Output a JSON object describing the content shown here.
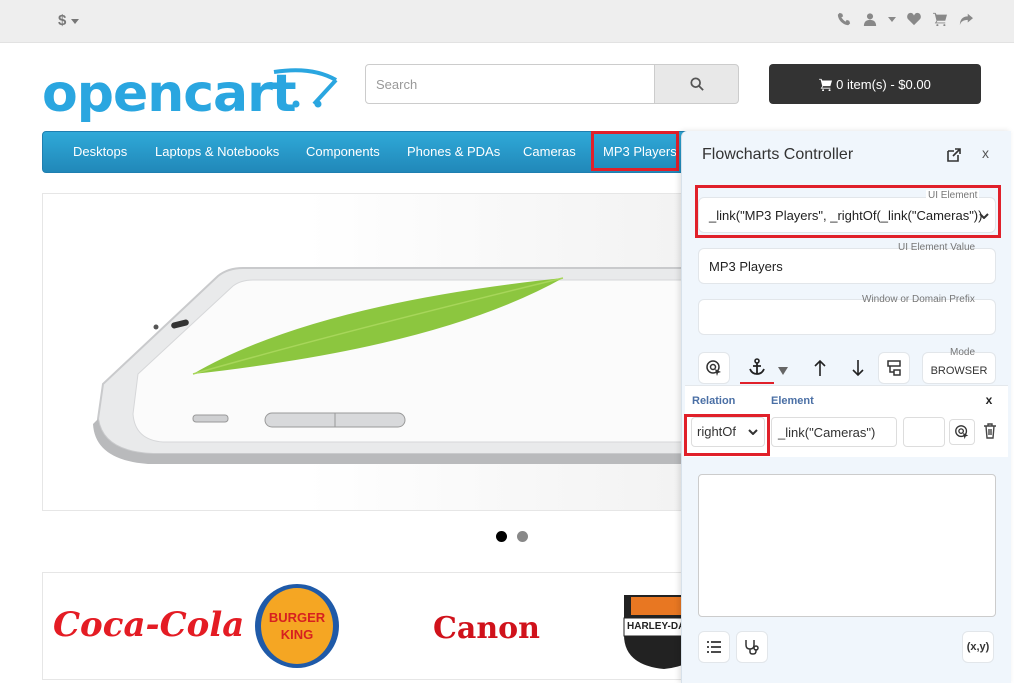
{
  "topbar": {
    "currency": "$"
  },
  "header": {
    "logo_text": "opencart",
    "search_placeholder": "Search",
    "cart_label": "0 item(s) - $0.00"
  },
  "menu": {
    "items": [
      "Desktops",
      "Laptops & Notebooks",
      "Components",
      "Phones & PDAs",
      "Cameras",
      "MP3 Players"
    ]
  },
  "brands": [
    "Coca-Cola",
    "BURGER KING",
    "Canon",
    "HARLEY-DAVIDSON"
  ],
  "panel": {
    "title": "Flowcharts Controller",
    "close": "x",
    "ui_element_label": "UI Element",
    "ui_element_value": "_link(\"MP3 Players\", _rightOf(_link(\"Cameras\"))",
    "ui_value_label": "UI Element Value",
    "ui_value": "MP3 Players",
    "prefix_label": "Window or Domain Prefix",
    "prefix_value": "",
    "mode_label": "Mode",
    "mode_value": "BROWSER",
    "relation": {
      "relation_header": "Relation",
      "element_header": "Element",
      "close": "x",
      "relation_value": "rightOf",
      "element_value": "_link(\"Cameras\")"
    },
    "xy_label": "(x,y)"
  },
  "colors": {
    "accent": "#2aa6e0",
    "highlight": "#e0202a",
    "menu": "#229ac8"
  }
}
